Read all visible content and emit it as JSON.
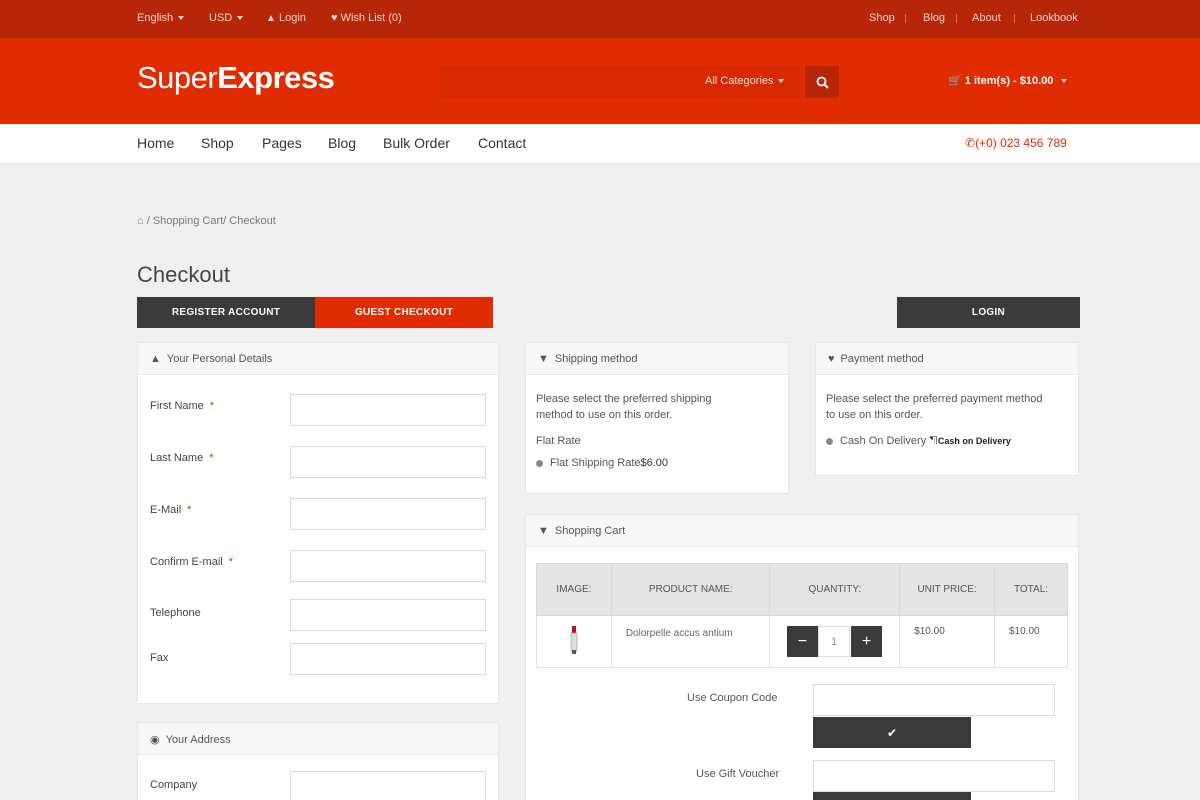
{
  "topbar": {
    "language": "English",
    "currency": "USD",
    "login": "Login",
    "wishlist": "Wish List (0)",
    "links": [
      "Shop",
      "Blog",
      "About",
      "Lookbook"
    ]
  },
  "header": {
    "logo_light": "Super",
    "logo_bold": "Express",
    "category_select": "All Categories",
    "cart_summary": "1 item(s) - $10.00"
  },
  "nav": {
    "items": [
      "Home",
      "Shop",
      "Pages",
      "Blog",
      "Bulk Order",
      "Contact"
    ],
    "phone": "(+0) 023 456 789"
  },
  "breadcrumb": {
    "items": [
      "Shopping Cart",
      "Checkout"
    ]
  },
  "page": {
    "title": "Checkout",
    "tabs": {
      "register": "REGISTER ACCOUNT",
      "guest": "GUEST CHECKOUT",
      "login": "LOGIN"
    }
  },
  "personal_details": {
    "heading": "Your Personal Details",
    "fields": [
      {
        "label": "First Name",
        "required": "*"
      },
      {
        "label": "Last Name",
        "required": "*"
      },
      {
        "label": "E-Mail",
        "required": "*"
      },
      {
        "label": "Confirm E-mail",
        "required": "*"
      },
      {
        "label": "Telephone",
        "required": ""
      },
      {
        "label": "Fax",
        "required": ""
      }
    ]
  },
  "address": {
    "heading": "Your Address",
    "fields": [
      {
        "label": "Company"
      }
    ]
  },
  "shipping": {
    "heading": "Shipping method",
    "instructions": "Please select the preferred shipping method to use on this order.",
    "group": "Flat Rate",
    "option": "Flat Shipping Rate",
    "option_price": "$6.00"
  },
  "payment": {
    "heading": "Payment method",
    "instructions": "Please select the preferred payment method to use on this order.",
    "option": "Cash On Delivery",
    "option_badge": "Cash on Delivery"
  },
  "shopping_cart": {
    "heading": "Shopping Cart",
    "columns": [
      "IMAGE:",
      "PRODUCT NAME:",
      "QUANTITY:",
      "UNIT PRICE:",
      "TOTAL:"
    ],
    "rows": [
      {
        "product": "Dolorpelle accus antium",
        "quantity": "1",
        "unit_price": "$10.00",
        "total": "$10.00"
      }
    ],
    "coupon_label": "Use Coupon Code",
    "voucher_label": "Use Gift Voucher"
  },
  "icons": {
    "search": "search-icon",
    "cart": "cart-icon",
    "user": "user-icon",
    "heart": "heart-icon",
    "home": "home-icon",
    "phone": "phone-icon",
    "map_pin": "map-pin-icon",
    "check": "check-icon"
  },
  "colors": {
    "brand_red": "#e12b00",
    "topbar_red": "#b72606",
    "dark_button": "#3a3a3a"
  }
}
